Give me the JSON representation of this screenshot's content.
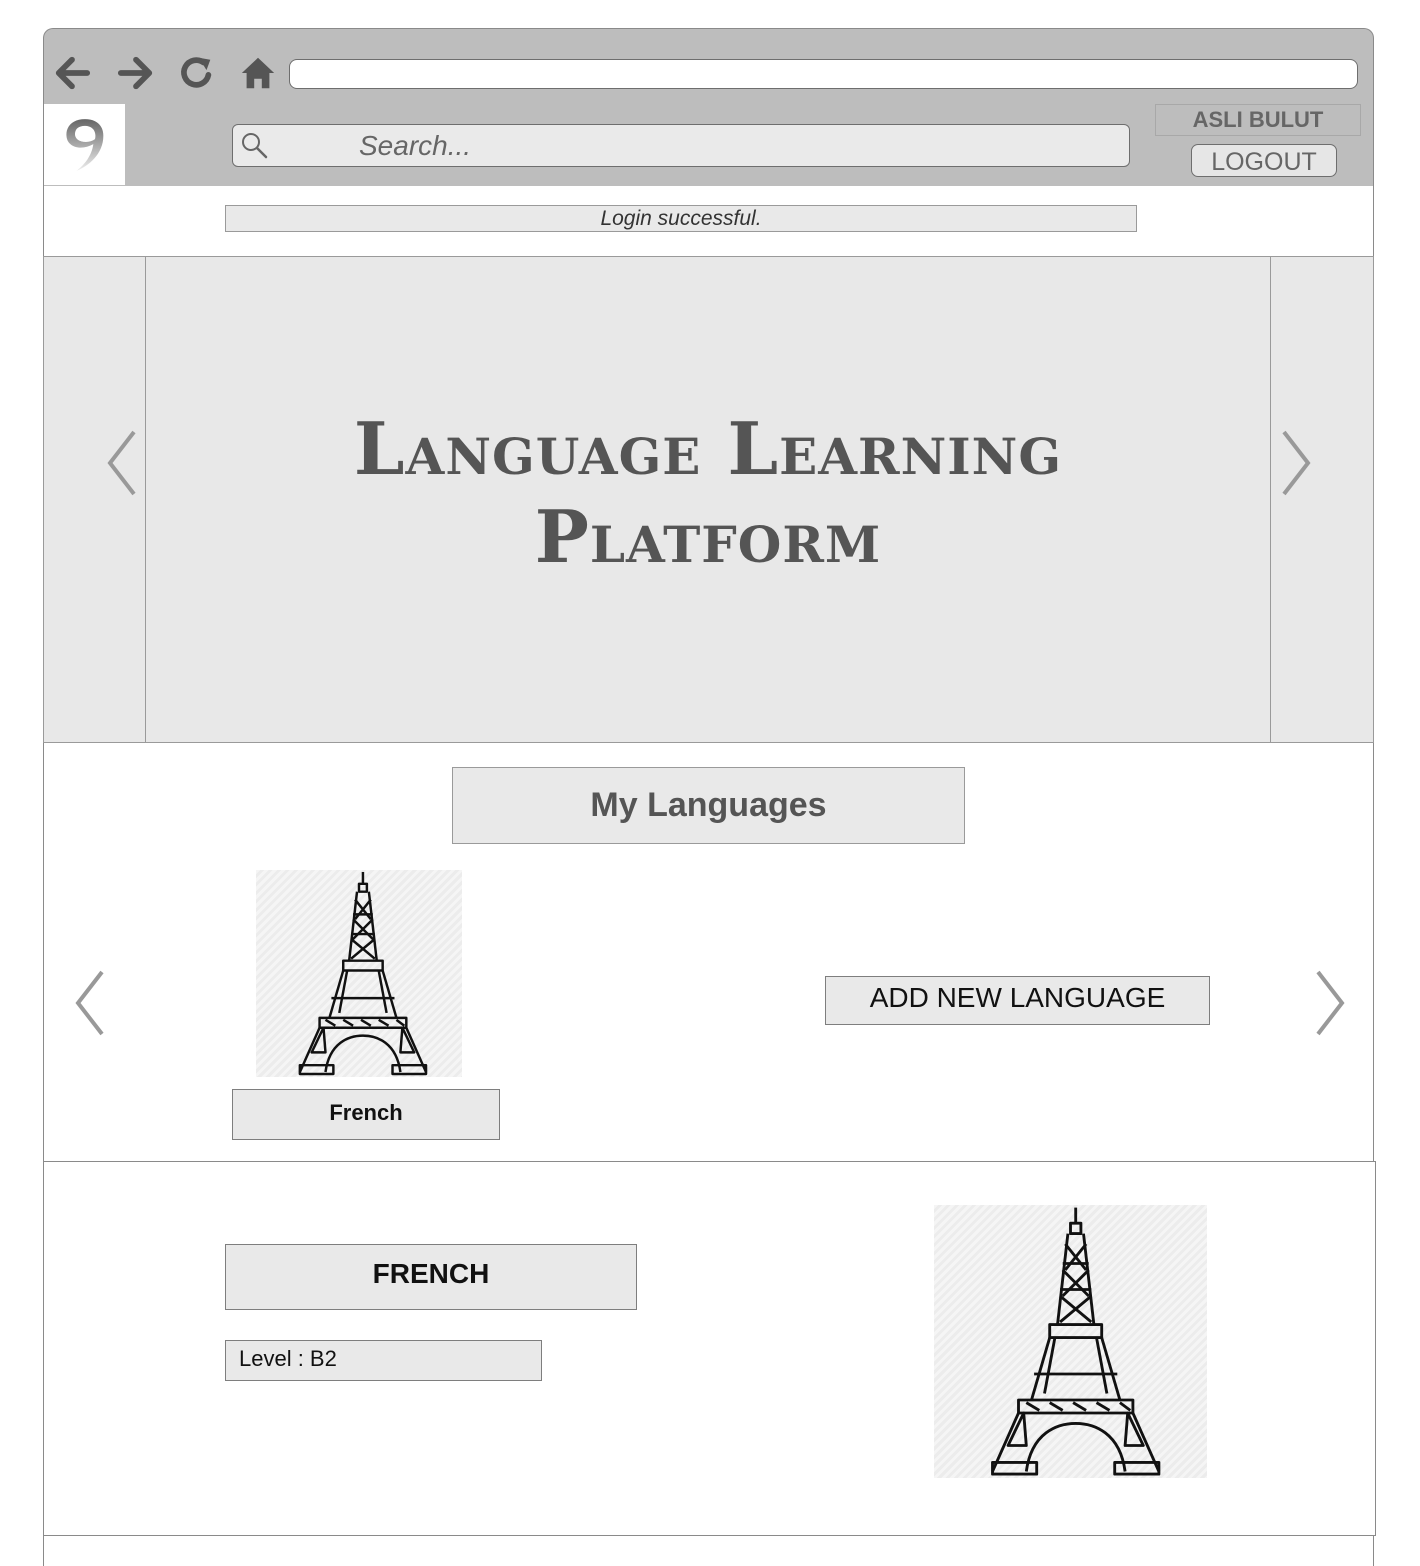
{
  "browser": {
    "back_icon": "arrow-left-icon",
    "forward_icon": "arrow-right-icon",
    "reload_icon": "reload-icon",
    "home_icon": "home-icon",
    "address": ""
  },
  "header": {
    "logo_icon": "logo-icon",
    "search_placeholder": "Search...",
    "user_name": "ASLI BULUT",
    "logout_label": "LOGOUT"
  },
  "status_message": "Login successful.",
  "hero": {
    "title_line1": "Language Learning",
    "title_line2": "Platform"
  },
  "languages_section": {
    "heading": "My Languages",
    "cards": [
      {
        "name": "French",
        "image": "eiffel-tower"
      }
    ],
    "add_button_label": "ADD NEW LANGUAGE"
  },
  "detail": {
    "title": "FRENCH",
    "level_text": "Level : B2",
    "image": "eiffel-tower"
  },
  "colors": {
    "chrome": "#bdbdbd",
    "panel": "#e8e8e8",
    "text_muted": "#666666"
  }
}
